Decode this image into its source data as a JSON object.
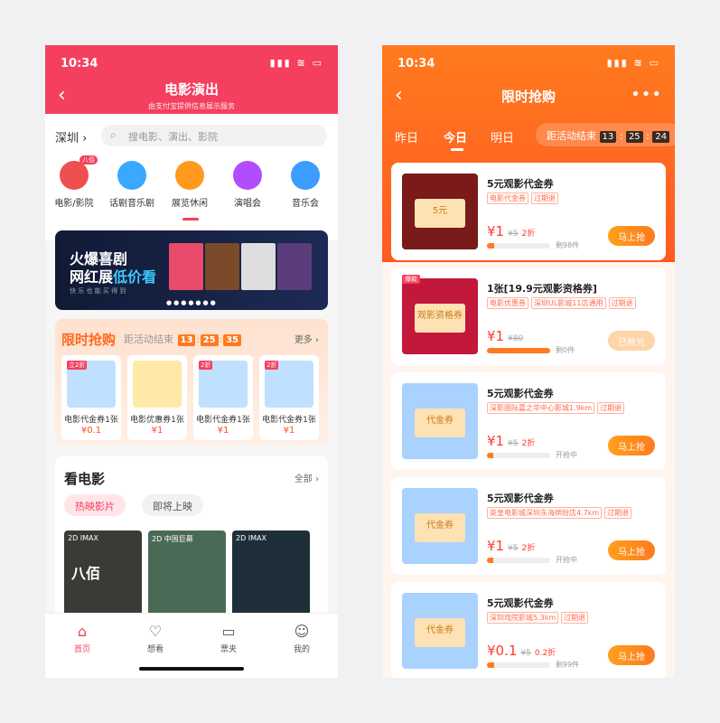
{
  "p1": {
    "status": {
      "time": "10:34",
      "signal": "▮▮▮ ≋ ▭"
    },
    "nav": {
      "title": "电影演出",
      "subtitle": "由支付宝提供信息展示服务"
    },
    "city": "深圳 ›",
    "search": {
      "placeholder": "搜电影、演出、影院"
    },
    "categories": [
      {
        "label": "电影/影院",
        "badge": "八佰",
        "color": "#ef4f4f"
      },
      {
        "label": "话剧音乐剧",
        "color": "#3aa8ff"
      },
      {
        "label": "展览休闲",
        "color": "#ff9a1e"
      },
      {
        "label": "演唱会",
        "color": "#b14cff"
      },
      {
        "label": "音乐会",
        "color": "#3c9cff"
      }
    ],
    "banner": {
      "line1": "火爆喜剧",
      "line2a": "网红展",
      "line2b": "低价看",
      "line3": "快 乐 也 能 买 得 到",
      "dots": "●●●●●●●"
    },
    "flash": {
      "title": "限时抢购",
      "cd_label": "距活动结束",
      "h": "13",
      "m": "25",
      "s": "35",
      "more": "更多 ›",
      "items": [
        {
          "tag": "立2折",
          "title": "电影代金券1张",
          "price": "¥0.1",
          "color": "#bfe0ff"
        },
        {
          "tag": "",
          "title": "电影优惠券1张",
          "price": "¥1",
          "color": "#ffe9a6"
        },
        {
          "tag": "2折",
          "title": "电影代金券1张",
          "price": "¥1",
          "color": "#bfe0ff"
        },
        {
          "tag": "2折",
          "title": "电影代金券1张",
          "price": "¥1",
          "color": "#bfe0ff"
        }
      ]
    },
    "movies": {
      "title": "看电影",
      "all": "全部 ›",
      "tab_on": "热映影片",
      "tab_off": "即将上映",
      "posters": [
        {
          "format": "2D IMAX",
          "name": "八佰",
          "color": "#3b3a35"
        },
        {
          "format": "2D 中国巨幕",
          "name": "",
          "color": "#4b6a55"
        },
        {
          "format": "2D IMAX",
          "name": "",
          "color": "#1f2f3a"
        }
      ]
    },
    "tabs": [
      {
        "label": "首页",
        "icon": "⌂"
      },
      {
        "label": "想看",
        "icon": "♡"
      },
      {
        "label": "票夹",
        "icon": "▭"
      },
      {
        "label": "我的",
        "icon": "☺"
      }
    ]
  },
  "p2": {
    "status": {
      "time": "10:34",
      "signal": "▮▮▮ ≋ ▭"
    },
    "nav": {
      "title": "限时抢购",
      "more": "•••"
    },
    "days": [
      "昨日",
      "今日",
      "明日"
    ],
    "cd": {
      "label": "距活动结束",
      "h": "13",
      "m": "25",
      "s": "24"
    },
    "coupons": [
      {
        "title": "5元观影代金券",
        "tags": [
          "电影代金券",
          "过期退"
        ],
        "price": "¥1",
        "orig": "¥5",
        "disc": "2折",
        "progress": 0.12,
        "status": "剩98件",
        "btn": "马上抢",
        "disabled": false,
        "ribbon": "",
        "img": "#7a1a1a",
        "vch": "5元"
      },
      {
        "title": "1张[19.9元观影资格券]",
        "tags": [
          "电影优惠券",
          "深圳UL影城11店通用",
          "过期退"
        ],
        "price": "¥1",
        "orig": "¥80",
        "disc": "",
        "progress": 1.0,
        "status": "剩0件",
        "btn": "已抢光",
        "disabled": true,
        "ribbon": "爆款",
        "img": "#c2183b",
        "vch": "观影资格券"
      },
      {
        "title": "5元观影代金券",
        "tags": [
          "深影国际嘉之华中心影城1.9km",
          "过期退"
        ],
        "price": "¥1",
        "orig": "¥5",
        "disc": "2折",
        "progress": 0.1,
        "status": "开抢中",
        "btn": "马上抢",
        "disabled": false,
        "ribbon": "",
        "img": "#a9d2ff",
        "vch": "代金券"
      },
      {
        "title": "5元观影代金券",
        "tags": [
          "英皇电影城深圳东海缤纷店4.7km",
          "过期退"
        ],
        "price": "¥1",
        "orig": "¥5",
        "disc": "2折",
        "progress": 0.1,
        "status": "开抢中",
        "btn": "马上抢",
        "disabled": false,
        "ribbon": "",
        "img": "#a9d2ff",
        "vch": "代金券"
      },
      {
        "title": "5元观影代金券",
        "tags": [
          "深圳戏院影城5.3km",
          "过期退"
        ],
        "price": "¥0.1",
        "orig": "¥5",
        "disc": "0.2折",
        "progress": 0.12,
        "status": "剩99件",
        "btn": "马上抢",
        "disabled": false,
        "ribbon": "",
        "img": "#a9d2ff",
        "vch": "代金券"
      }
    ]
  }
}
